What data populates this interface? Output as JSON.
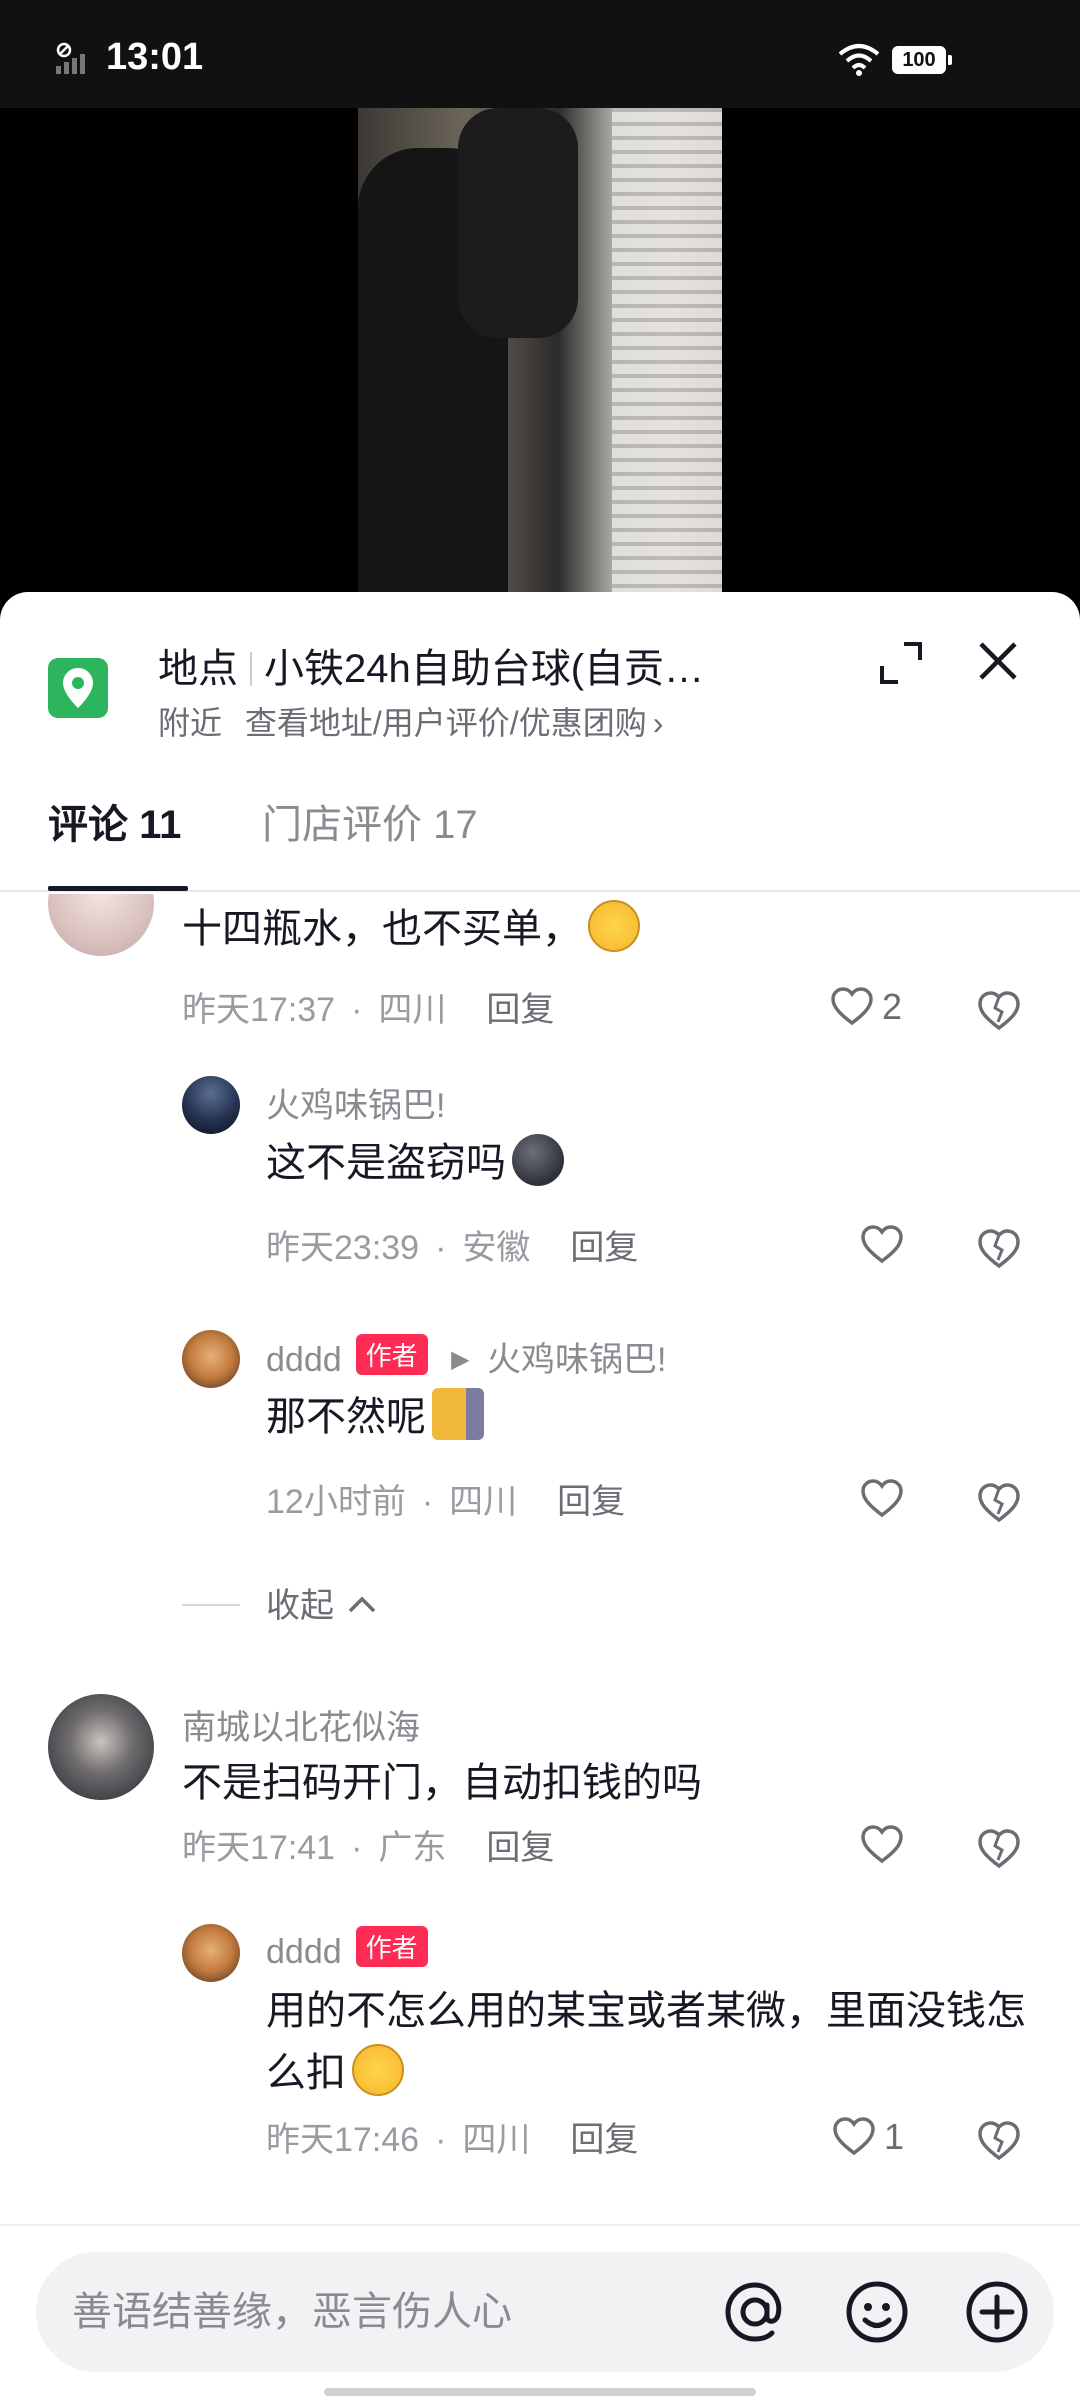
{
  "status_bar": {
    "time": "13:01",
    "battery": "100"
  },
  "location": {
    "label": "地点",
    "name": "小铁24h自助台球(自贡…",
    "nearby": "附近",
    "sub_link": "查看地址/用户评价/优惠团购",
    "chevron": "›",
    "pin_color": "#2db55d"
  },
  "tabs": [
    {
      "label": "评论 11",
      "active": true
    },
    {
      "label": "门店评价 17",
      "active": false
    }
  ],
  "comments": [
    {
      "text": "十四瓶水，也不买单，",
      "time": "昨天17:37",
      "region": "四川",
      "reply": "回复",
      "likes": "2"
    },
    {
      "name": "火鸡味锅巴!",
      "text": "这不是盗窃吗",
      "time": "昨天23:39",
      "region": "安徽",
      "reply": "回复",
      "likes": ""
    },
    {
      "name": "dddd",
      "tag": "作者",
      "reply_to": "火鸡味锅巴!",
      "text": "那不然呢",
      "time": "12小时前",
      "region": "四川",
      "reply": "回复",
      "likes": ""
    },
    {
      "collapse": "收起"
    },
    {
      "name": "南城以北花似海",
      "text": "不是扫码开门，自动扣钱的吗",
      "time": "昨天17:41",
      "region": "广东",
      "reply": "回复",
      "likes": ""
    },
    {
      "name": "dddd",
      "tag": "作者",
      "text": "用的不怎么用的某宝或者某微，里面没钱怎么扣",
      "time": "昨天17:46",
      "region": "四川",
      "reply": "回复",
      "likes": "1"
    }
  ],
  "input": {
    "placeholder": "善语结善缘，恶言伤人心"
  },
  "dot": "·",
  "icons": [
    "location-pin-icon",
    "expand-icon",
    "close-icon",
    "heart-icon",
    "dislike-icon",
    "at-icon",
    "emoji-icon",
    "add-icon"
  ],
  "colors": {
    "accent": "#fe2c55",
    "text": "#161823",
    "muted": "#8a8b91"
  }
}
